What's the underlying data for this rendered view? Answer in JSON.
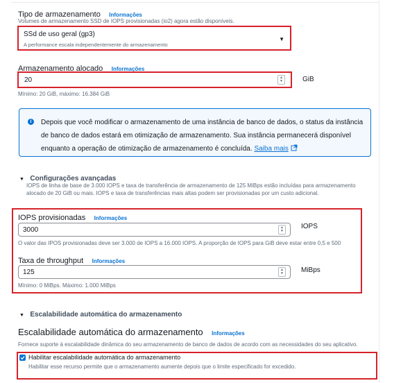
{
  "storage_type": {
    "label": "Tipo de armazenamento",
    "info": "Informações",
    "description": "Volumes de armazenamento SSD de IOPS provisionadas (io2) agora estão disponíveis.",
    "selected": "SSd de uso geral (gp3)",
    "selected_hint": "A performance escala independentemente do armazenamento"
  },
  "allocated_storage": {
    "label": "Armazenamento alocado",
    "info": "Informações",
    "value": "20",
    "unit": "GiB",
    "hint": "Mínimo: 20 GiB, máximo: 16.384 GiB"
  },
  "alert": {
    "text": "Depois que você modificar o armazenamento de uma instância de banco de dados, o status da instância de banco de dados estará em otimização de armazenamento. Sua instância permanecerá disponível enquanto a operação de otimização de armazenamento é concluída.",
    "link": "Saiba mais"
  },
  "advanced": {
    "title": "Configurações avançadas",
    "description": "IOPS de linha de base de 3.000 IOPS e taxa de transferência de armazenamento de 125 MiBps estão incluídas para armazenamento alocado de 20 GiB ou mais. IOPS e taxa de transferências mais altas podem ser provisionadas por um custo adicional."
  },
  "iops": {
    "label": "IOPS provisionadas",
    "info": "Informações",
    "value": "3000",
    "unit": "IOPS",
    "hint": "O valor das IPOS provisionadas deve ser 3.000 de IOPS a 16.000 IOPS. A proporção de IOPS para GiB deve estar entre 0,5 e 500"
  },
  "throughput": {
    "label": "Taxa de throughput",
    "info": "Informações",
    "value": "125",
    "unit": "MiBps",
    "hint": "Mínimo: 0 MiBps. Máximo: 1.000 MiBps"
  },
  "autoscaling": {
    "collapsible_title": "Escalabilidade automática do armazenamento",
    "heading": "Escalabilidade automática do armazenamento",
    "info": "Informações",
    "description": "Fornece suporte à escalabilidade dinâmica do seu armazenamento de banco de dados de acordo com as necessidades do seu aplicativo.",
    "checkbox_label": "Habilitar escalabilidade automática do armazenamento",
    "checkbox_checked": true,
    "checkbox_hint": "Habilitar esse recurso permite que o armazenamento aumente depois que o limite especificado for excedido."
  },
  "colors": {
    "highlight": "#d6222b",
    "link": "#0972d3",
    "alert_bg": "#f2f8fd"
  }
}
